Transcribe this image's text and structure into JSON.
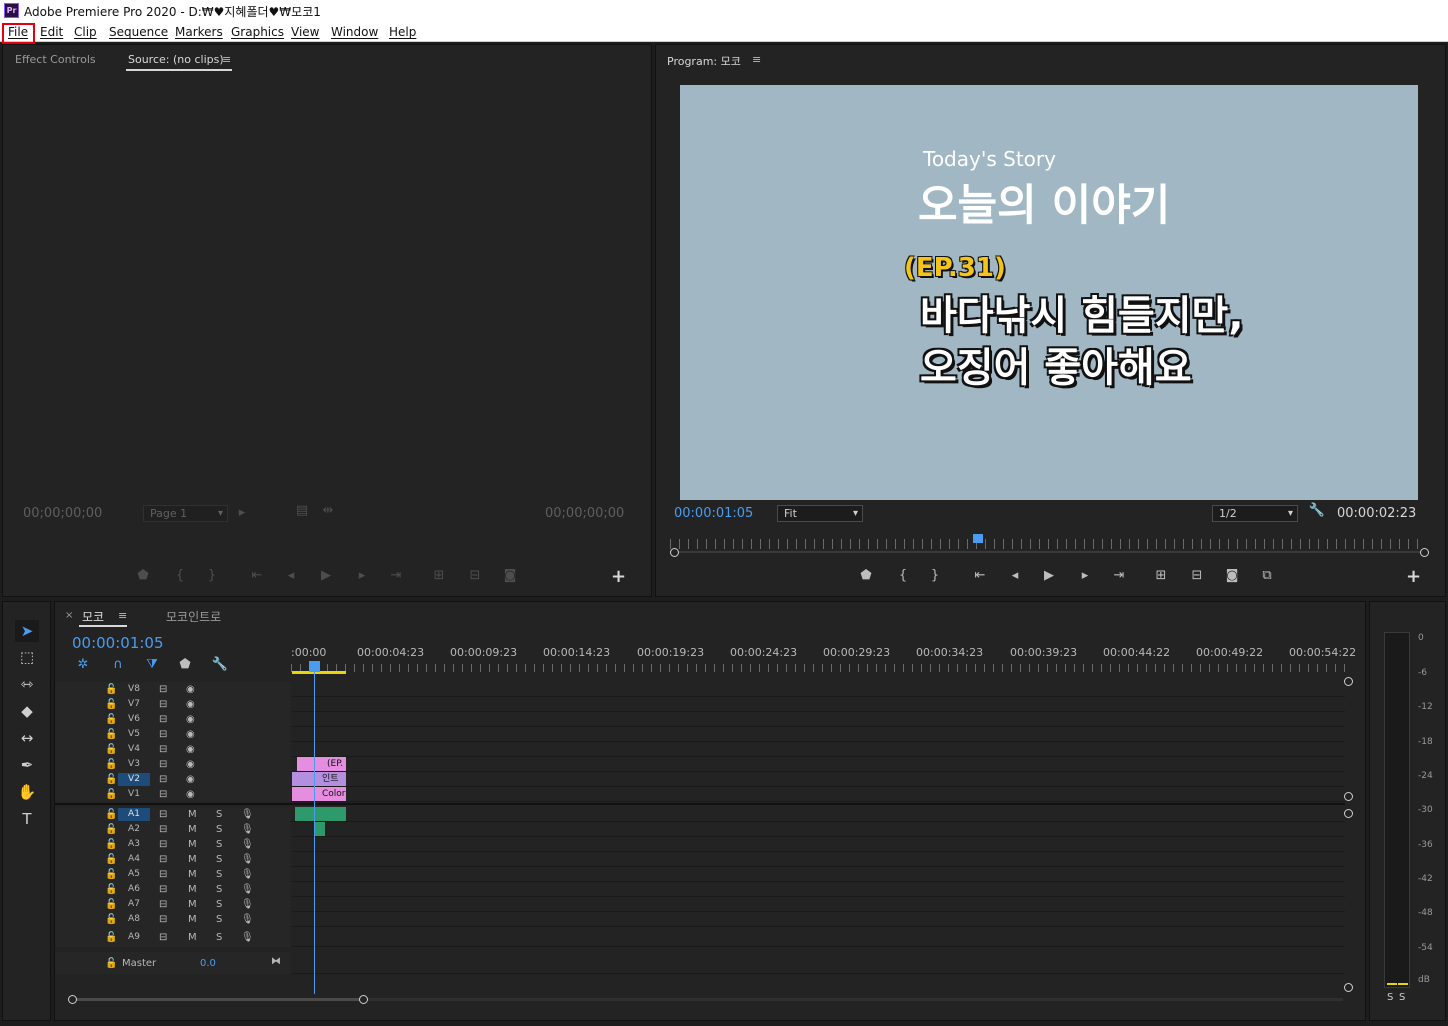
{
  "titlebar": {
    "app_icon": "Pr",
    "title": "Adobe Premiere Pro 2020 - D:₩♥지혜폴더♥₩모코1"
  },
  "menu": {
    "file": "File",
    "edit": "Edit",
    "clip": "Clip",
    "sequence": "Sequence",
    "markers": "Markers",
    "graphics": "Graphics",
    "view": "View",
    "window": "Window",
    "help": "Help"
  },
  "source": {
    "tab_effect_controls": "Effect Controls",
    "tab_source": "Source: (no clips)",
    "menu_icon": "≡",
    "tc_left": "00;00;00;00",
    "tc_right": "00;00;00;00",
    "page_select": "Page 1"
  },
  "program": {
    "tab_label": "Program: 모코",
    "menu_icon": "≡",
    "current_tc": "00:00:01:05",
    "duration_tc": "00:00:02:23",
    "zoom_select": "Fit",
    "resolution_select": "1/2",
    "video": {
      "line1": "Today's Story",
      "line2": "오늘의 이야기",
      "line3": "(EP.31)",
      "line4": "바다낚시 힘들지만,",
      "line5": "오징어 좋아해요"
    }
  },
  "timeline": {
    "tab_active": "모코",
    "tab_other": "모코인트로",
    "close_icon": "×",
    "menu_icon": "≡",
    "current_tc": "00:00:01:05",
    "ruler_ticks": [
      ":00:00",
      "00:00:04:23",
      "00:00:09:23",
      "00:00:14:23",
      "00:00:19:23",
      "00:00:24:23",
      "00:00:29:23",
      "00:00:34:23",
      "00:00:39:23",
      "00:00:44:22",
      "00:00:49:22",
      "00:00:54:22"
    ],
    "video_tracks": [
      "V8",
      "V7",
      "V6",
      "V5",
      "V4",
      "V3",
      "V2",
      "V1"
    ],
    "audio_tracks": [
      "A1",
      "A2",
      "A3",
      "A4",
      "A5",
      "A6",
      "A7",
      "A8",
      "A9"
    ],
    "mute_label": "M",
    "solo_label": "S",
    "master_label": "Master",
    "master_value": "0.0",
    "clips": {
      "v3": "(EP.",
      "v2": "인트",
      "v1": "Color"
    }
  },
  "meters": {
    "scale": [
      "0",
      "-6",
      "-12",
      "-18",
      "-24",
      "-30",
      "-36",
      "-42",
      "-48",
      "-54",
      "dB"
    ],
    "solo_left": "S",
    "solo_right": "S"
  },
  "colors": {
    "accent": "#4a9cf0",
    "highlight_red": "#e2000f",
    "clip_pink": "#e58ee0",
    "clip_purple": "#b48fe0",
    "audio_clip": "#2e9a6b",
    "video_bg": "#a1b7c4",
    "ep_yellow": "#f5c41a"
  }
}
